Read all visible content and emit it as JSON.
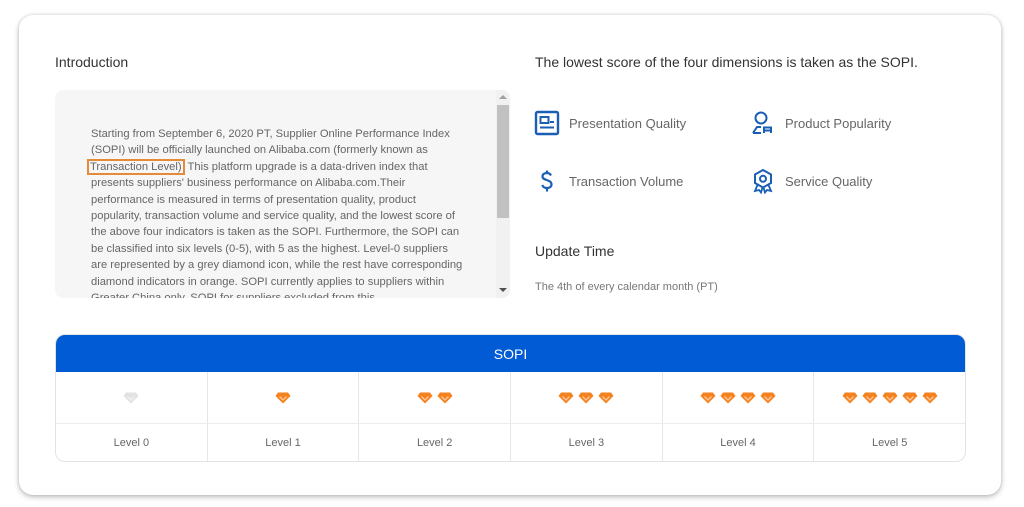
{
  "introduction": {
    "title": "Introduction",
    "text_before": "Starting from September 6, 2020 PT, Supplier Online Performance Index (SOPI) will be officially launched on Alibaba.com (formerly known as",
    "highlighted": "Transaction Level)",
    "text_after": "This platform upgrade is a data-driven index that presents suppliers' business performance on Alibaba.com.Their performance is measured in terms of presentation quality, product popularity, transaction volume and service quality, and the lowest score of the above four indicators is taken as the SOPI. Furthermore, the SOPI can be classified into six levels (0-5), with 5 as the highest. Level-0 suppliers are represented by a grey diamond icon, while the rest have corresponding diamond indicators in orange. SOPI currently applies to suppliers within Greater China only. SOPI for suppliers excluded from this"
  },
  "dimensions": {
    "title": "The lowest score of the four dimensions is taken as the SOPI.",
    "items": [
      {
        "label": "Presentation Quality",
        "icon": "presentation-card-icon"
      },
      {
        "label": "Product Popularity",
        "icon": "user-product-icon"
      },
      {
        "label": "Transaction Volume",
        "icon": "dollar-icon"
      },
      {
        "label": "Service Quality",
        "icon": "badge-award-icon"
      }
    ],
    "icon_color": "#1a5fb4"
  },
  "update": {
    "title": "Update Time",
    "text": "The 4th of every calendar month (PT)"
  },
  "sopi": {
    "header": "SOPI",
    "header_color": "#005bd5",
    "gem_color": "#f5821f",
    "gem_grey_color": "#e2e2e2",
    "levels": [
      {
        "label": "Level 0",
        "gems": 0
      },
      {
        "label": "Level 1",
        "gems": 1
      },
      {
        "label": "Level 2",
        "gems": 2
      },
      {
        "label": "Level 3",
        "gems": 3
      },
      {
        "label": "Level 4",
        "gems": 4
      },
      {
        "label": "Level 5",
        "gems": 5
      }
    ]
  }
}
